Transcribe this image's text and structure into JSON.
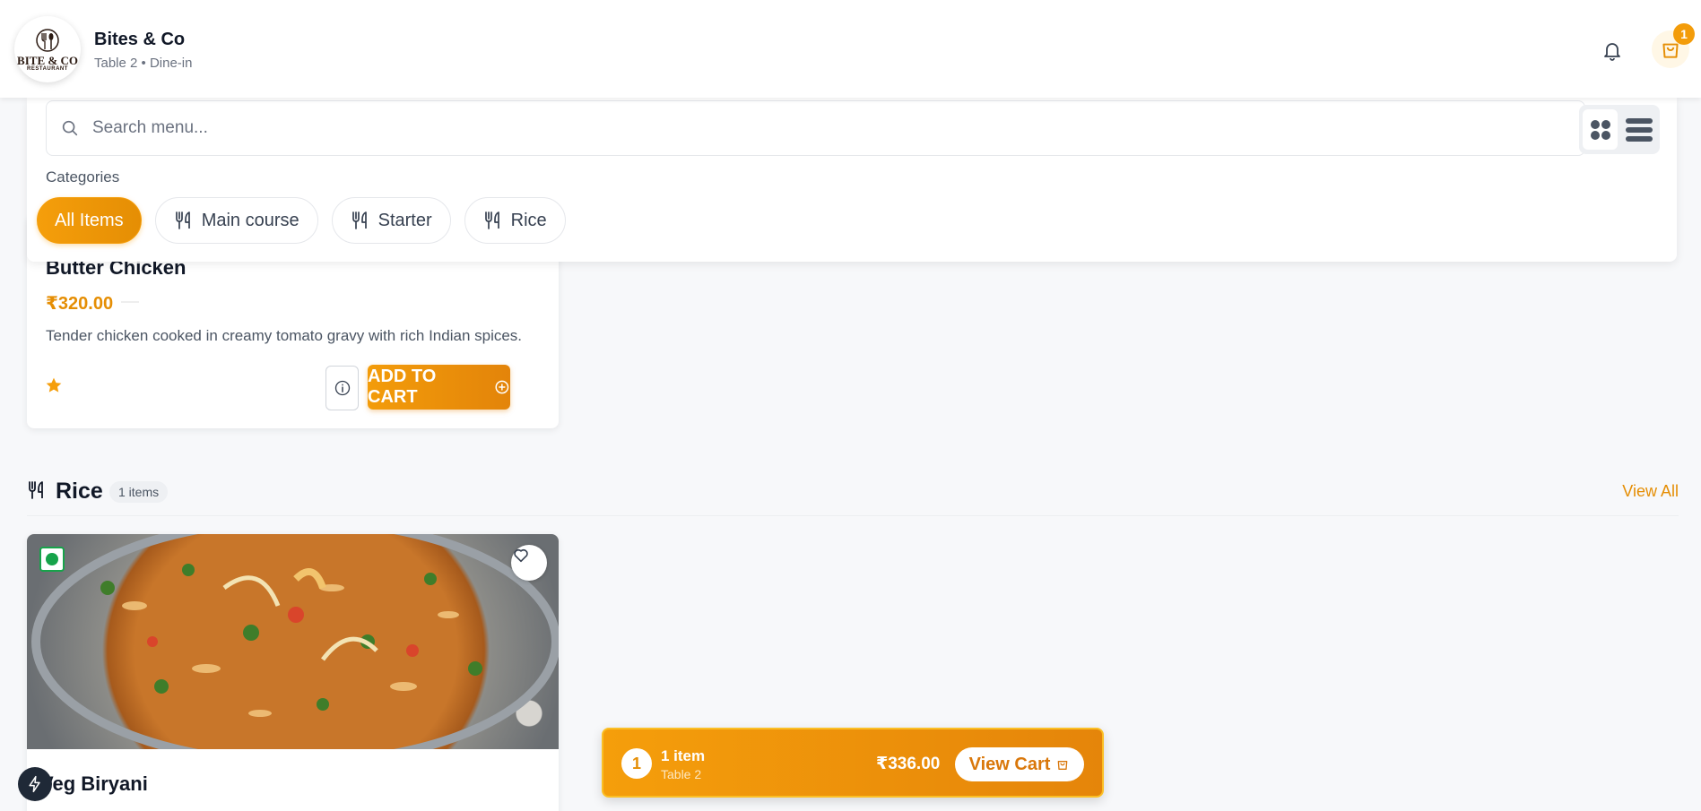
{
  "header": {
    "logo": {
      "main": "BITE & CO",
      "sub": "RESTAURANT"
    },
    "restaurant_name": "Bites & Co",
    "table_info": "Table 2 • Dine-in",
    "cart_count": "1"
  },
  "search": {
    "placeholder": "Search menu..."
  },
  "categories": {
    "label": "Categories",
    "items": [
      "All Items",
      "Main course",
      "Starter",
      "Rice"
    ],
    "active": "All Items"
  },
  "items": {
    "butter_chicken": {
      "name": "Butter Chicken",
      "price": "₹320.00",
      "description": "Tender chicken cooked in creamy tomato gravy with rich Indian spices.",
      "add_label": "ADD TO CART"
    },
    "veg_biryani": {
      "name": "Veg Biryani"
    }
  },
  "rice_section": {
    "title": "Rice",
    "count": "1 items",
    "view_all": "View All"
  },
  "cart_bar": {
    "count": "1",
    "items_label": "1 item",
    "table": "Table 2",
    "total": "₹336.00",
    "view_label": "View Cart"
  },
  "colors": {
    "accent": "#f59e0b",
    "accent_dark": "#e58e04",
    "veg": "#16a34a"
  }
}
